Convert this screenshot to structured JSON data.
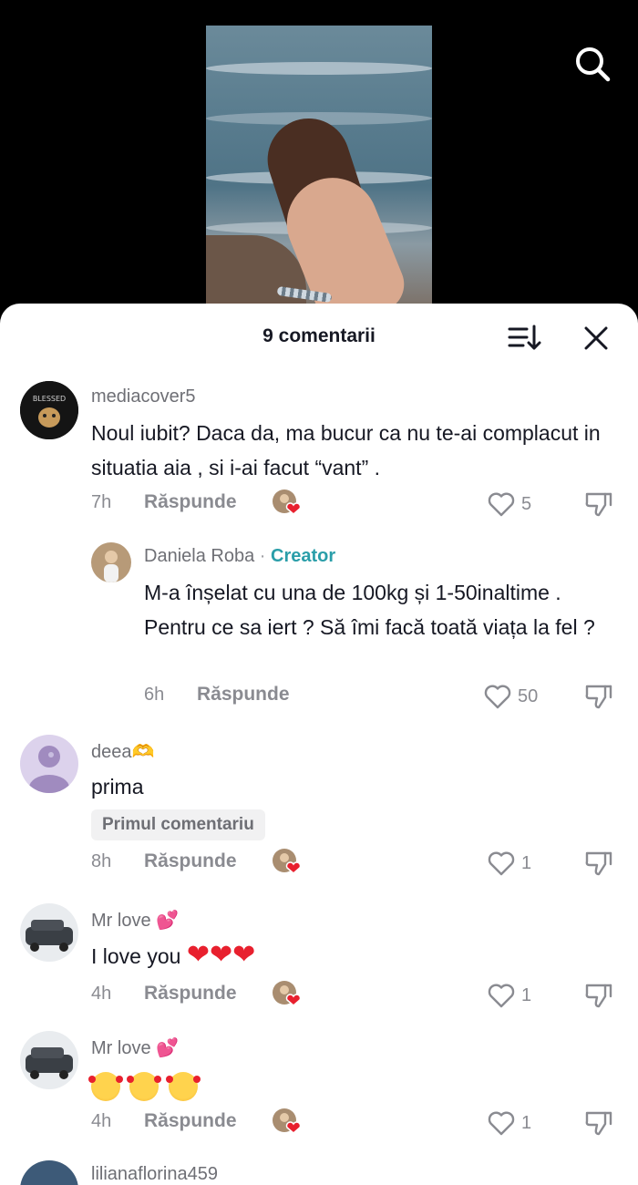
{
  "header": {
    "comment_count": "9 comentarii"
  },
  "icons": {
    "search": "search-icon",
    "sort": "sort-icon",
    "close": "close-icon",
    "like": "heart-outline-icon",
    "dislike": "thumbs-down-icon"
  },
  "colors": {
    "creator_accent": "#2a9ea9",
    "heart_red": "#e8202e",
    "muted": "#8a8b91"
  },
  "comments": [
    {
      "username": "mediacover5",
      "text": "Noul iubit? Daca da, ma bucur ca nu te-ai complacut in situatia aia , si i-ai facut “vant” .",
      "time": "7h",
      "reply_label": "Răspunde",
      "likes": "5"
    },
    {
      "username": "Daniela Roba",
      "separator": "·",
      "creator_label": "Creator",
      "text": "M-a înșelat cu una de 100kg și 1-50inaltime . Pentru ce sa iert ? Să îmi facă toată viața la fel ?",
      "time": "6h",
      "reply_label": "Răspunde",
      "likes": "50"
    },
    {
      "username": "deea🫶",
      "text": "prima",
      "badge": "Primul comentariu",
      "time": "8h",
      "reply_label": "Răspunde",
      "likes": "1"
    },
    {
      "username": "Mr love 💕",
      "text": "I love you",
      "time": "4h",
      "reply_label": "Răspunde",
      "likes": "1"
    },
    {
      "username": "Mr love 💕",
      "text": "",
      "time": "4h",
      "reply_label": "Răspunde",
      "likes": "1"
    },
    {
      "username": "lilianaflorina459"
    }
  ]
}
